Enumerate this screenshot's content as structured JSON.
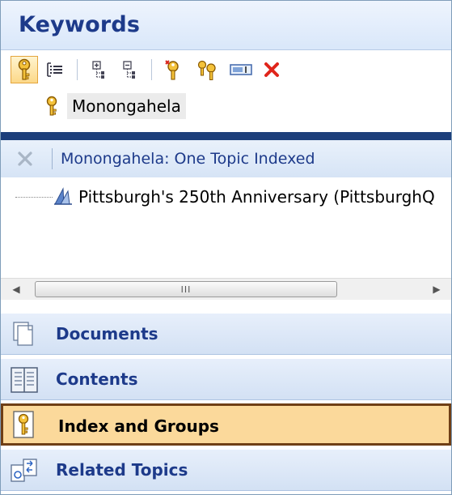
{
  "keywords_panel": {
    "title": "Keywords",
    "toolbar": [
      {
        "icon": "key-icon",
        "active": true
      },
      {
        "icon": "list-view-icon"
      },
      {
        "icon": "expand-tree-icon"
      },
      {
        "icon": "collapse-tree-icon"
      },
      {
        "icon": "new-keyword-icon"
      },
      {
        "icon": "new-subkeyword-icon"
      },
      {
        "icon": "rename-icon"
      },
      {
        "icon": "delete-icon",
        "color": "#e0251b"
      }
    ],
    "selected_keyword": "Monongahela"
  },
  "results_panel": {
    "title": "Monongahela: One Topic Indexed",
    "items": [
      {
        "label": "Pittsburgh's 250th Anniversary (PittsburghQ",
        "icon": "topic-icon"
      }
    ],
    "scrollbar_thumb_label": "III"
  },
  "nav": [
    {
      "label": "Documents",
      "icon": "documents-icon",
      "selected": false
    },
    {
      "label": "Contents",
      "icon": "contents-icon",
      "selected": false
    },
    {
      "label": "Index and Groups",
      "icon": "index-icon",
      "selected": true
    },
    {
      "label": "Related Topics",
      "icon": "related-topics-icon",
      "selected": false
    }
  ],
  "colors": {
    "header_text": "#1d3a8a",
    "splitter": "#1d3f7b",
    "selected_bg": "#fbd99b",
    "selected_border": "#6f3f16",
    "delete": "#e0251b"
  }
}
